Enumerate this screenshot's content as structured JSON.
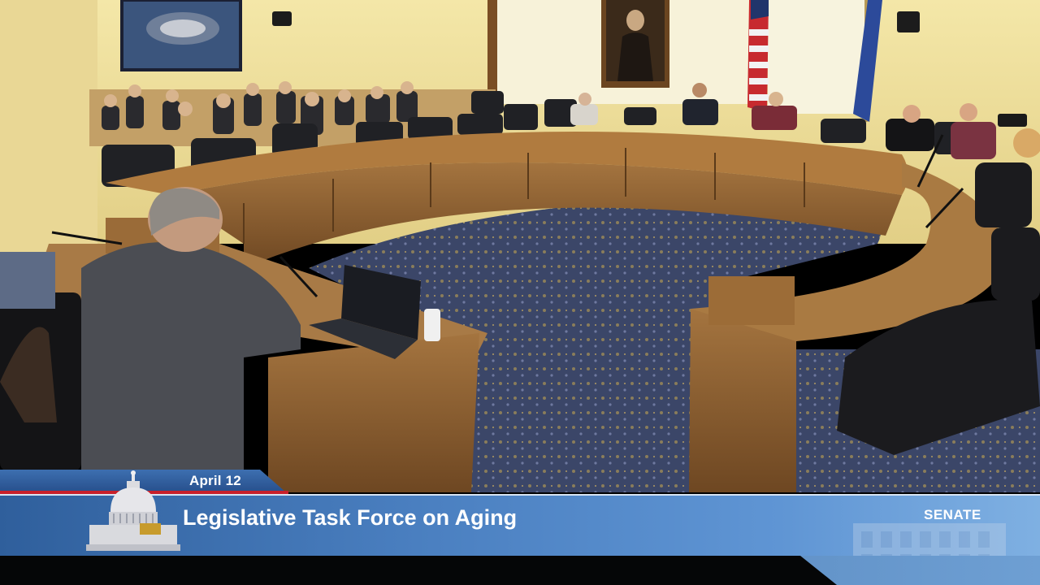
{
  "broadcast": {
    "date": "April 12",
    "title": "Legislative Task Force on Aging",
    "chamber": "SENATE"
  },
  "colors": {
    "wall": "#efe1a0",
    "wood": "#8a5d30",
    "carpet": "#3d4a6b",
    "bar_blue": "#3d6fb0",
    "accent_red": "#c8202b"
  }
}
